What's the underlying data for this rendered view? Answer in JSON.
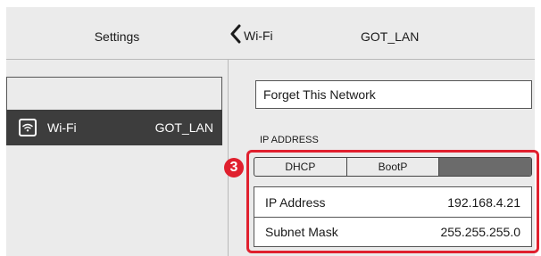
{
  "header": {
    "left_title": "Settings",
    "back_label": "Wi-Fi",
    "right_title": "GOT_LAN"
  },
  "sidebar": {
    "items": [
      {
        "label": "Wi-Fi",
        "value": "GOT_LAN",
        "icon": "wifi-icon",
        "selected": true
      }
    ]
  },
  "detail": {
    "forget_label": "Forget This Network",
    "section_label": "IP ADDRESS",
    "badge": "3",
    "segments": [
      {
        "label": "DHCP",
        "selected": false
      },
      {
        "label": "BootP",
        "selected": false
      },
      {
        "label": "",
        "selected": true
      }
    ],
    "rows": [
      {
        "label": "IP Address",
        "value": "192.168.4.21"
      },
      {
        "label": "Subnet Mask",
        "value": "255.255.255.0"
      }
    ]
  },
  "colors": {
    "highlight": "#e0202e",
    "selected_row": "#3d3d3d",
    "selected_segment": "#6b6b6b",
    "background": "#ebebeb"
  }
}
